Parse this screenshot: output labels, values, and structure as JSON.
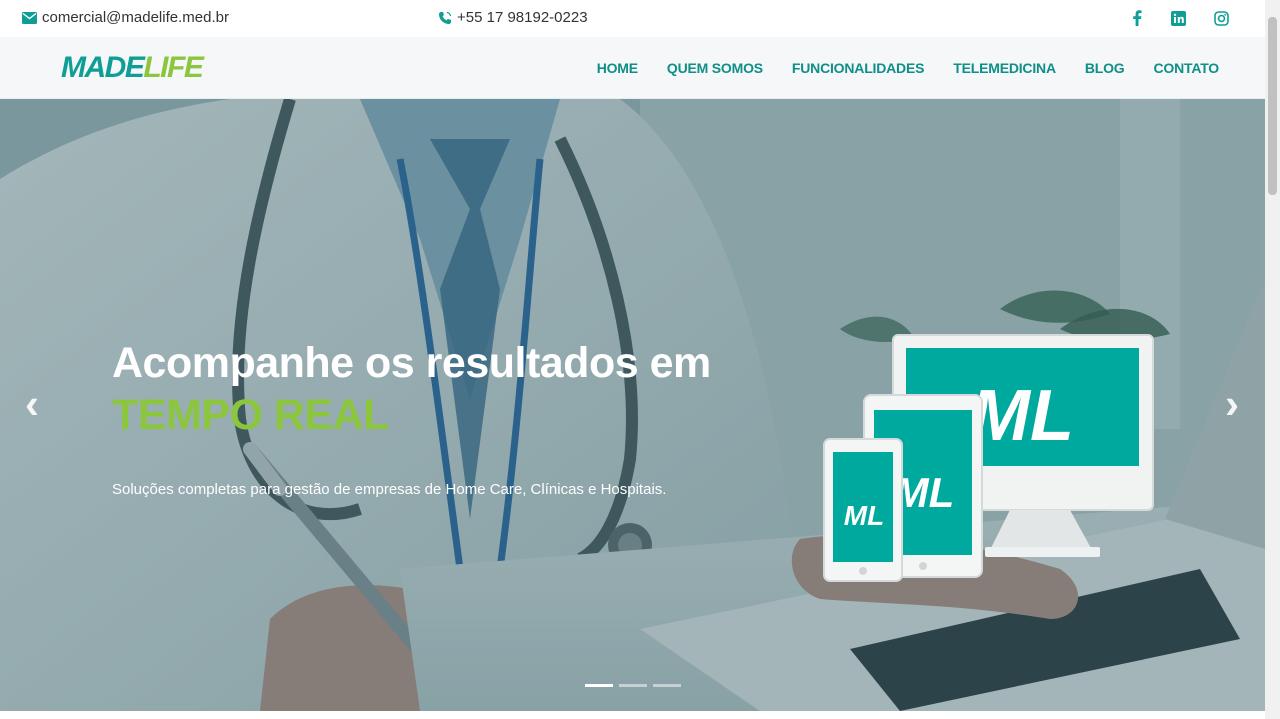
{
  "topbar": {
    "email": "comercial@madelife.med.br",
    "phone": "+55 17 98192-0223",
    "social": [
      "facebook-icon",
      "linkedin-icon",
      "instagram-icon"
    ]
  },
  "brand": {
    "made": "MADE",
    "life": "LIFE"
  },
  "nav": {
    "items": [
      "HOME",
      "QUEM SOMOS",
      "FUNCIONALIDADES",
      "TELEMEDICINA",
      "BLOG",
      "CONTATO"
    ]
  },
  "hero": {
    "title": "Acompanhe os resultados em",
    "accent": "TEMPO REAL",
    "subtitle": "Soluções completas para gestão de empresas de Home Care, Clínicas e Hospitais.",
    "device_label": "ML",
    "prev_icon": "‹",
    "next_icon": "›",
    "slides": 3,
    "active_slide": 1
  },
  "colors": {
    "primary": "#0f9e96",
    "accent": "#8cc63f",
    "nav_text": "#0f8f88"
  }
}
